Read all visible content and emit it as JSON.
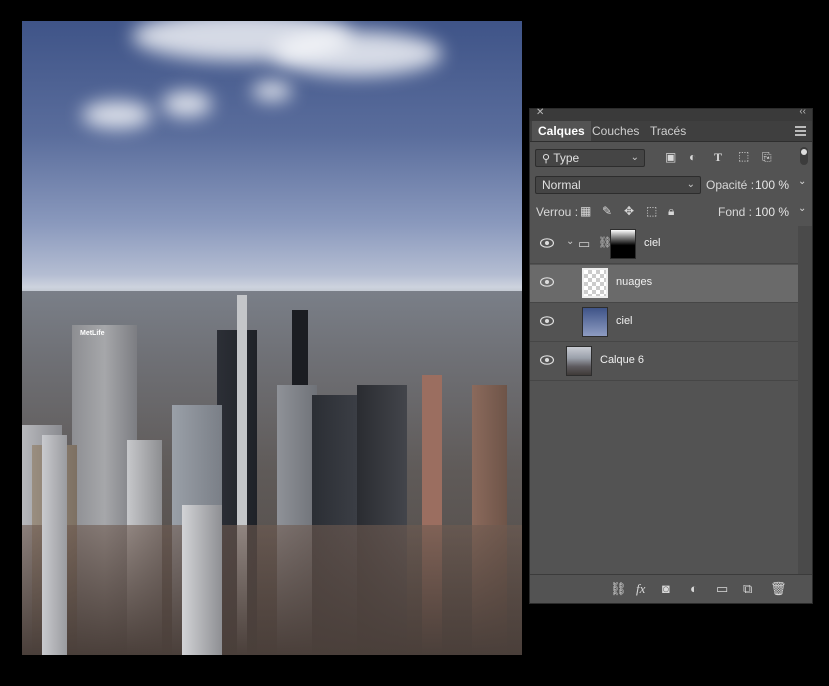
{
  "canvas": {
    "label": "",
    "sign_text": "MetLife"
  },
  "panel": {
    "close_glyph": "✕",
    "collapse_glyph": "‹‹",
    "tabs": [
      {
        "label": "Calques",
        "active": true
      },
      {
        "label": "Couches",
        "active": false
      },
      {
        "label": "Tracés",
        "active": false
      }
    ],
    "filter": {
      "kind_label": "Type",
      "icons": [
        "image-filter-icon",
        "adjustment-filter-icon",
        "type-filter-icon",
        "shape-filter-icon",
        "smart-object-filter-icon"
      ]
    },
    "blend": {
      "mode": "Normal",
      "opacity_label": "Opacité :",
      "opacity_value": "100 %"
    },
    "lock": {
      "label": "Verrou :",
      "icons": [
        "lock-transparent-icon",
        "lock-image-icon",
        "lock-position-icon",
        "lock-artboard-icon",
        "lock-all-icon"
      ],
      "fill_label": "Fond :",
      "fill_value": "100 %"
    },
    "layers": [
      {
        "name": "ciel",
        "type": "group",
        "visible": true,
        "selected": false,
        "has_mask": true
      },
      {
        "name": "nuages",
        "type": "layer",
        "visible": true,
        "selected": true,
        "indented": true
      },
      {
        "name": "ciel",
        "type": "layer",
        "visible": true,
        "selected": false,
        "indented": true
      },
      {
        "name": "Calque 6",
        "type": "layer",
        "visible": true,
        "selected": false
      }
    ],
    "footer_icons": [
      "link-icon",
      "fx-icon",
      "mask-icon",
      "adjustment-icon",
      "folder-icon",
      "new-layer-icon",
      "trash-icon"
    ],
    "footer_fx_label": "fx"
  }
}
